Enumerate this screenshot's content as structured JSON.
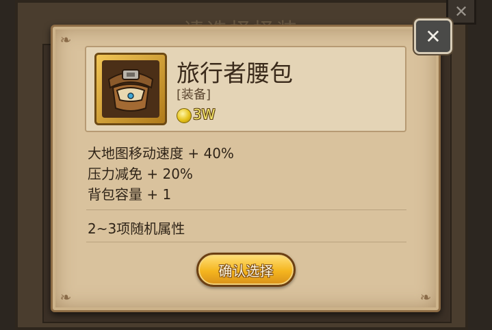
{
  "background": {
    "title": "请选择择装",
    "close_icon": "crossed-swords-icon"
  },
  "popup": {
    "close_icon": "crossed-swords-icon",
    "item": {
      "name": "旅行者腰包",
      "type": "[装备]",
      "price": "3W",
      "icon": "travel-belt-bag-icon",
      "currency_icon": "gold-coin-icon"
    },
    "stats": [
      "大地图移动速度 + 40%",
      "压力减免 + 20%",
      "背包容量 + 1"
    ],
    "random_attributes": "2~3项随机属性",
    "confirm_label": "确认选择"
  },
  "colors": {
    "parchment": "#d9c29d",
    "button_gold": "#f4b51e",
    "price_yellow": "#f5e66a"
  }
}
